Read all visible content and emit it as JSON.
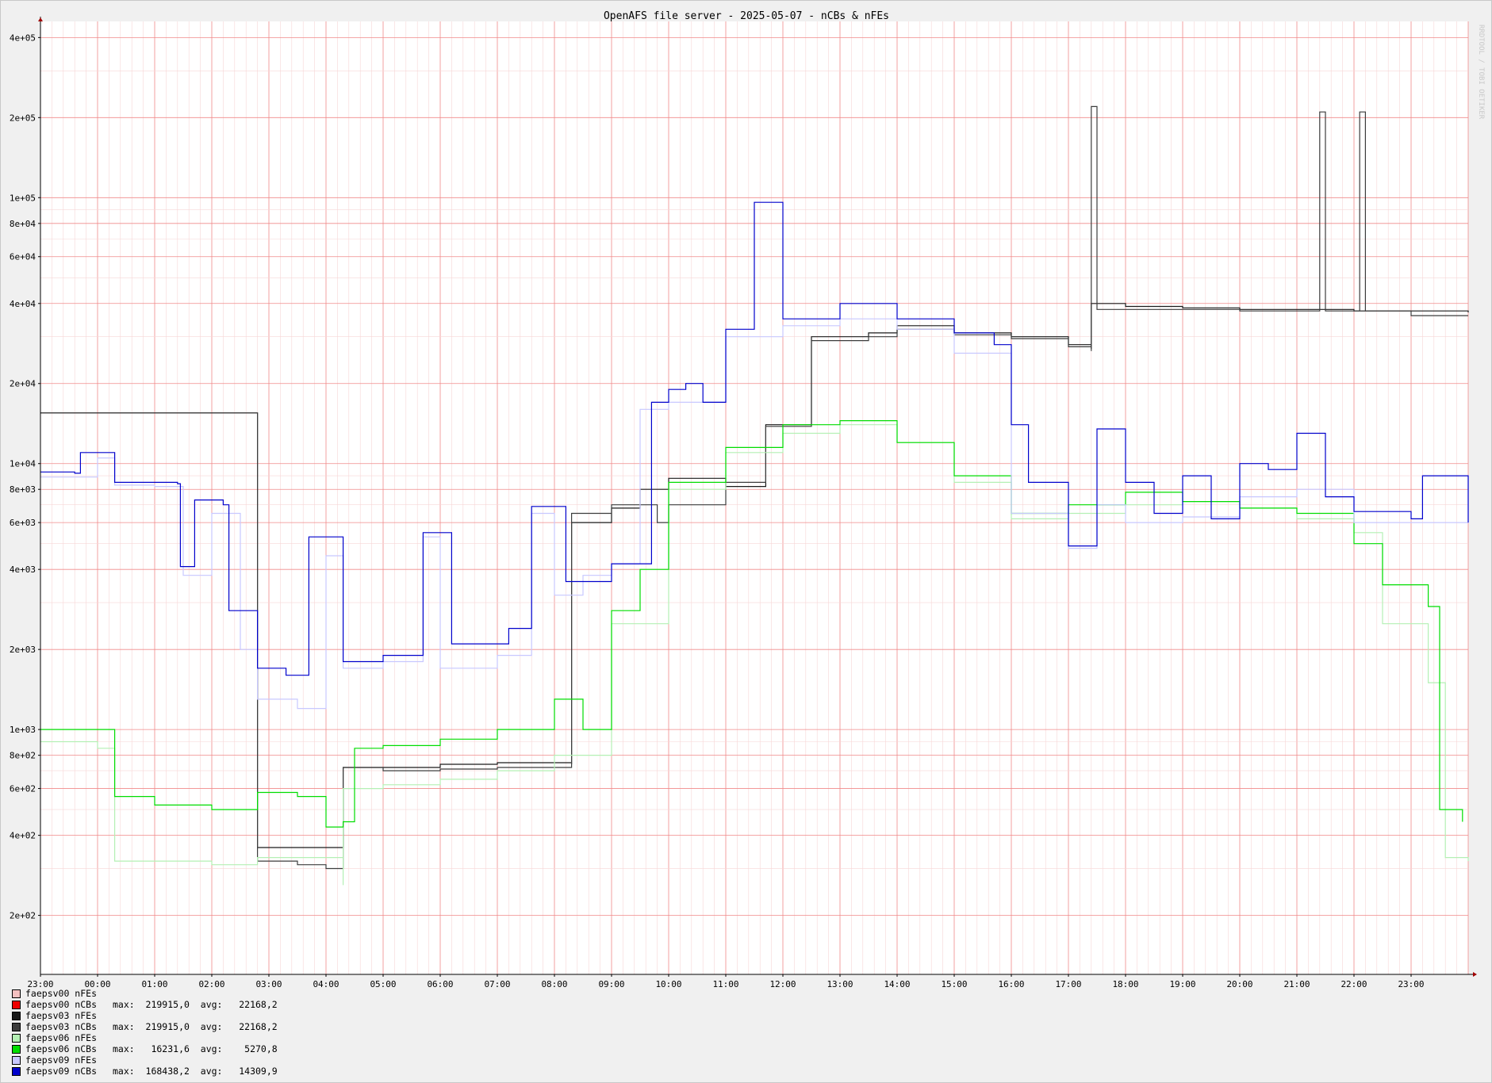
{
  "chart_data": {
    "type": "line",
    "title": "OpenAFS file server - 2025-05-07 - nCBs & nFEs",
    "watermark": "RRDTOOL / TOBI OETIKER",
    "yscale": "log",
    "ylim": [
      120,
      460000
    ],
    "ytick_values": [
      200,
      400,
      600,
      800,
      1000,
      2000,
      4000,
      6000,
      8000,
      10000,
      20000,
      40000,
      60000,
      80000,
      100000,
      200000,
      400000
    ],
    "ytick_labels": [
      "2e+02",
      "4e+02",
      "6e+02",
      "8e+02",
      "1e+03",
      "2e+03",
      "4e+03",
      "6e+03",
      "8e+03",
      "1e+04",
      "2e+04",
      "4e+04",
      "6e+04",
      "8e+04",
      "1e+05",
      "2e+05",
      "4e+05"
    ],
    "xlim": [
      0,
      25
    ],
    "xtick_labels": [
      "23:00",
      "00:00",
      "01:00",
      "02:00",
      "03:00",
      "04:00",
      "05:00",
      "06:00",
      "07:00",
      "08:00",
      "09:00",
      "10:00",
      "11:00",
      "12:00",
      "13:00",
      "14:00",
      "15:00",
      "16:00",
      "17:00",
      "18:00",
      "19:00",
      "20:00",
      "21:00",
      "22:00",
      "23:00"
    ],
    "grid": true,
    "legend_position": "bottom-left",
    "series": [
      {
        "name": "faepsv00 nFEs",
        "color": "#f5c0c0",
        "stats": "",
        "points": []
      },
      {
        "name": "faepsv00 nCBs",
        "color": "#ee0000",
        "stats": "max:  219915,0  avg:   22168,2",
        "points": []
      },
      {
        "name": "faepsv03 nFEs",
        "color": "#1a1a1a",
        "stats": "",
        "points": [
          [
            0,
            15500
          ],
          [
            3.8,
            15200
          ],
          [
            3.8,
            360
          ],
          [
            5.3,
            380
          ],
          [
            5.3,
            720
          ],
          [
            7,
            740
          ],
          [
            8,
            750
          ],
          [
            9.3,
            740
          ],
          [
            9.3,
            6000
          ],
          [
            10,
            6800
          ],
          [
            10.5,
            8000
          ],
          [
            11,
            8800
          ],
          [
            12,
            8200
          ],
          [
            12.7,
            14000
          ],
          [
            13.5,
            30000
          ],
          [
            14.5,
            31000
          ],
          [
            15,
            33000
          ],
          [
            16,
            31000
          ],
          [
            17,
            30000
          ],
          [
            18,
            28000
          ],
          [
            18.4,
            27000
          ],
          [
            18.4,
            40000
          ],
          [
            19,
            39000
          ],
          [
            20,
            38500
          ],
          [
            21,
            38000
          ],
          [
            22,
            38000
          ],
          [
            23,
            37500
          ],
          [
            25,
            37000
          ]
        ]
      },
      {
        "name": "faepsv03 nCBs",
        "color": "#3c3c3c",
        "stats": "max:  219915,0  avg:   22168,2",
        "points": [
          [
            0,
            15500
          ],
          [
            3.8,
            15300
          ],
          [
            3.8,
            320
          ],
          [
            4.5,
            310
          ],
          [
            5,
            300
          ],
          [
            5.3,
            320
          ],
          [
            5.3,
            720
          ],
          [
            6,
            700
          ],
          [
            7,
            710
          ],
          [
            8,
            720
          ],
          [
            9.3,
            720
          ],
          [
            9.3,
            6500
          ],
          [
            10,
            7000
          ],
          [
            10.8,
            6000
          ],
          [
            11,
            7000
          ],
          [
            12,
            8500
          ],
          [
            12.7,
            13800
          ],
          [
            13.5,
            29000
          ],
          [
            14.5,
            30000
          ],
          [
            15,
            32000
          ],
          [
            16,
            30500
          ],
          [
            17,
            29500
          ],
          [
            18,
            27500
          ],
          [
            18.4,
            26500
          ],
          [
            18.4,
            220000
          ],
          [
            18.5,
            38000
          ],
          [
            19,
            38000
          ],
          [
            20,
            38000
          ],
          [
            21,
            37500
          ],
          [
            22,
            37500
          ],
          [
            22.4,
            210000
          ],
          [
            22.5,
            37500
          ],
          [
            23,
            37500
          ],
          [
            23.1,
            210000
          ],
          [
            23.2,
            37500
          ],
          [
            24,
            36000
          ],
          [
            25,
            36000
          ]
        ]
      },
      {
        "name": "faepsv06 nFEs",
        "color": "#b4f0b4",
        "stats": "",
        "points": [
          [
            0,
            900
          ],
          [
            1,
            850
          ],
          [
            1.3,
            320
          ],
          [
            3,
            310
          ],
          [
            3.8,
            330
          ],
          [
            5.3,
            260
          ],
          [
            5.3,
            600
          ],
          [
            6,
            620
          ],
          [
            7,
            650
          ],
          [
            8,
            700
          ],
          [
            9,
            800
          ],
          [
            10,
            2500
          ],
          [
            11,
            8000
          ],
          [
            12,
            11000
          ],
          [
            13,
            13000
          ],
          [
            14,
            14000
          ],
          [
            15,
            12000
          ],
          [
            16,
            8500
          ],
          [
            17,
            6200
          ],
          [
            18,
            6500
          ],
          [
            19,
            7000
          ],
          [
            20,
            7200
          ],
          [
            21,
            6800
          ],
          [
            22,
            6200
          ],
          [
            23,
            5500
          ],
          [
            23.5,
            2500
          ],
          [
            24.3,
            1500
          ],
          [
            24.6,
            330
          ],
          [
            25,
            320
          ]
        ]
      },
      {
        "name": "faepsv06 nCBs",
        "color": "#00dd00",
        "stats": "max:   16231,6  avg:    5270,8",
        "points": [
          [
            0,
            1000
          ],
          [
            1,
            1000
          ],
          [
            1.3,
            560
          ],
          [
            2,
            520
          ],
          [
            3,
            500
          ],
          [
            3.8,
            580
          ],
          [
            4.5,
            560
          ],
          [
            5,
            430
          ],
          [
            5.3,
            450
          ],
          [
            5.5,
            850
          ],
          [
            6,
            870
          ],
          [
            7,
            920
          ],
          [
            8,
            1000
          ],
          [
            9,
            1300
          ],
          [
            9.5,
            1000
          ],
          [
            10,
            2800
          ],
          [
            10.5,
            4000
          ],
          [
            11,
            8500
          ],
          [
            12,
            11500
          ],
          [
            13,
            14000
          ],
          [
            14,
            14500
          ],
          [
            15,
            12000
          ],
          [
            16,
            9000
          ],
          [
            17,
            6500
          ],
          [
            18,
            7000
          ],
          [
            19,
            7800
          ],
          [
            20,
            7200
          ],
          [
            21,
            6800
          ],
          [
            22,
            6500
          ],
          [
            23,
            5000
          ],
          [
            23.5,
            3500
          ],
          [
            24.3,
            2900
          ],
          [
            24.5,
            500
          ],
          [
            24.9,
            450
          ]
        ]
      },
      {
        "name": "faepsv09 nFEs",
        "color": "#c8c8ff",
        "stats": "",
        "points": [
          [
            0,
            8900
          ],
          [
            1,
            10500
          ],
          [
            1.3,
            8300
          ],
          [
            2,
            8200
          ],
          [
            2.5,
            3800
          ],
          [
            3,
            6500
          ],
          [
            3.5,
            2000
          ],
          [
            3.8,
            1300
          ],
          [
            4.5,
            1200
          ],
          [
            5,
            4500
          ],
          [
            5.3,
            1700
          ],
          [
            6,
            1800
          ],
          [
            6.7,
            5300
          ],
          [
            7,
            1700
          ],
          [
            8,
            1900
          ],
          [
            8.6,
            6500
          ],
          [
            9,
            3200
          ],
          [
            9.5,
            3800
          ],
          [
            10,
            4200
          ],
          [
            10.5,
            16000
          ],
          [
            11,
            17000
          ],
          [
            12,
            30000
          ],
          [
            13,
            33000
          ],
          [
            14,
            35000
          ],
          [
            15,
            32000
          ],
          [
            16,
            26000
          ],
          [
            17,
            6500
          ],
          [
            18,
            4800
          ],
          [
            18.5,
            7000
          ],
          [
            19,
            6000
          ],
          [
            20,
            6300
          ],
          [
            21,
            7500
          ],
          [
            22,
            8000
          ],
          [
            23,
            6000
          ],
          [
            24,
            6000
          ],
          [
            25,
            9000
          ]
        ]
      },
      {
        "name": "faepsv09 nCBs",
        "color": "#0000cc",
        "stats": "max:  168438,2  avg:   14309,9",
        "points": [
          [
            0,
            9300
          ],
          [
            0.6,
            9200
          ],
          [
            0.7,
            11000
          ],
          [
            1.3,
            8500
          ],
          [
            2.4,
            8400
          ],
          [
            2.45,
            4100
          ],
          [
            2.7,
            4100
          ],
          [
            2.7,
            7300
          ],
          [
            3.2,
            7000
          ],
          [
            3.3,
            2800
          ],
          [
            3.8,
            1700
          ],
          [
            4.3,
            1600
          ],
          [
            4.7,
            5300
          ],
          [
            5.3,
            1800
          ],
          [
            6,
            1900
          ],
          [
            6.7,
            5500
          ],
          [
            7.2,
            2100
          ],
          [
            8.2,
            2400
          ],
          [
            8.6,
            6900
          ],
          [
            9.2,
            3600
          ],
          [
            10,
            4200
          ],
          [
            10.7,
            17000
          ],
          [
            11,
            19000
          ],
          [
            11.3,
            20000
          ],
          [
            11.6,
            17000
          ],
          [
            12,
            32000
          ],
          [
            12.5,
            96000
          ],
          [
            13,
            35000
          ],
          [
            14,
            40000
          ],
          [
            15,
            35000
          ],
          [
            16,
            31000
          ],
          [
            16.7,
            28000
          ],
          [
            17,
            14000
          ],
          [
            17.3,
            8500
          ],
          [
            18,
            4900
          ],
          [
            18.5,
            13500
          ],
          [
            19,
            8500
          ],
          [
            19.5,
            6500
          ],
          [
            20,
            9000
          ],
          [
            20.5,
            6200
          ],
          [
            21,
            10000
          ],
          [
            21.5,
            9500
          ],
          [
            22,
            13000
          ],
          [
            22.5,
            7500
          ],
          [
            23,
            6600
          ],
          [
            24,
            6200
          ],
          [
            24.2,
            9000
          ],
          [
            25,
            9000
          ],
          [
            25,
            6000
          ]
        ]
      }
    ]
  }
}
